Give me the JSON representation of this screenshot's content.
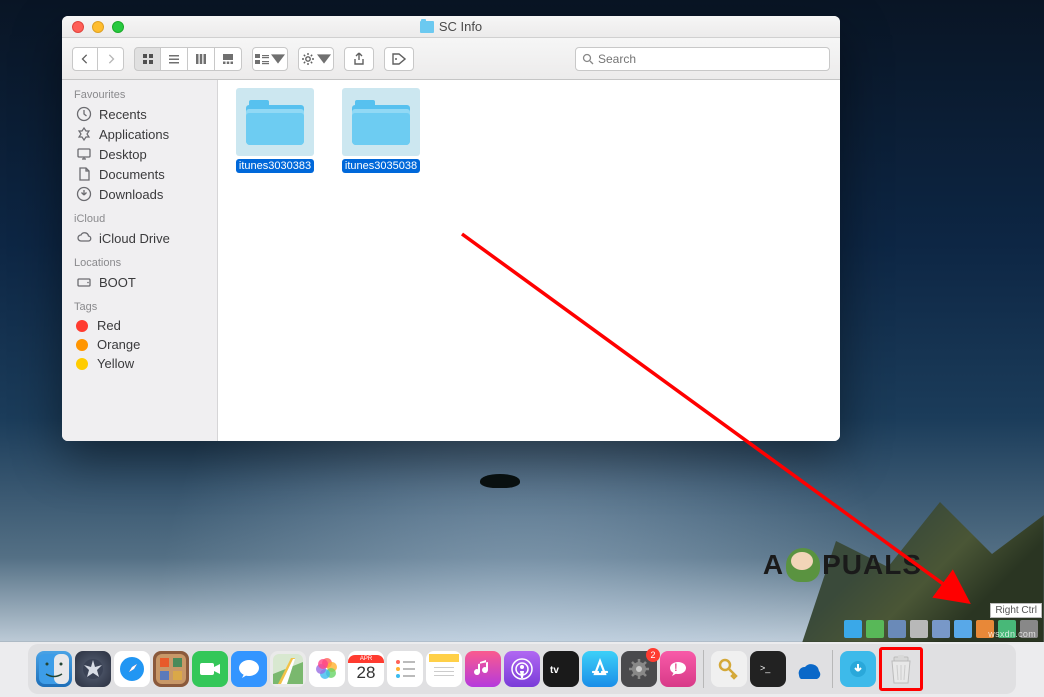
{
  "window": {
    "title": "SC Info"
  },
  "toolbar": {
    "search_placeholder": "Search"
  },
  "sidebar": {
    "favourites_header": "Favourites",
    "favourites": [
      {
        "icon": "clock",
        "label": "Recents"
      },
      {
        "icon": "app",
        "label": "Applications"
      },
      {
        "icon": "desktop",
        "label": "Desktop"
      },
      {
        "icon": "doc",
        "label": "Documents"
      },
      {
        "icon": "download",
        "label": "Downloads"
      }
    ],
    "icloud_header": "iCloud",
    "icloud": [
      {
        "icon": "cloud",
        "label": "iCloud Drive"
      }
    ],
    "locations_header": "Locations",
    "locations": [
      {
        "icon": "disk",
        "label": "BOOT"
      }
    ],
    "tags_header": "Tags",
    "tags": [
      {
        "color": "#ff3b30",
        "label": "Red"
      },
      {
        "color": "#ff9500",
        "label": "Orange"
      },
      {
        "color": "#ffcc00",
        "label": "Yellow"
      }
    ]
  },
  "files": [
    {
      "name": "itunes3030383",
      "selected": true
    },
    {
      "name": "itunes3035038",
      "selected": true
    }
  ],
  "dock": {
    "calendar_day": "28",
    "settings_badge": "2"
  },
  "tooltip": "Right Ctrl",
  "watermark_site": "wsxdn.com",
  "logo_text_a": "A",
  "logo_text_b": "PUALS"
}
